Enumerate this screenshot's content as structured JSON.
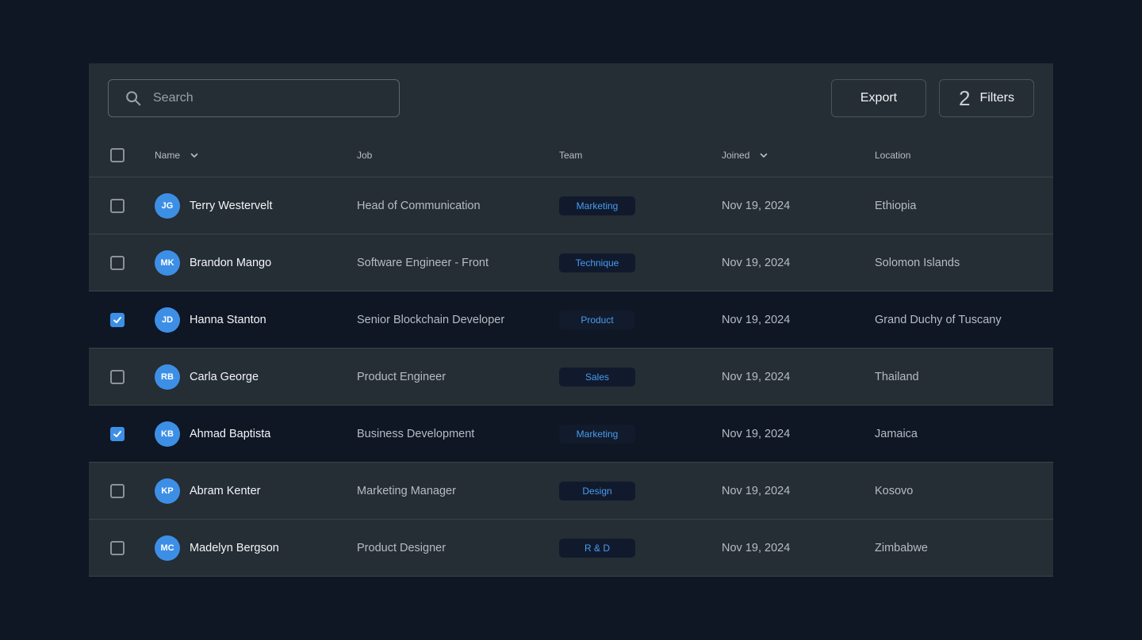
{
  "search": {
    "placeholder": "Search"
  },
  "toolbar": {
    "export_label": "Export",
    "filters_count": "2",
    "filters_label": "Filters"
  },
  "columns": {
    "name": "Name",
    "job": "Job",
    "team": "Team",
    "joined": "Joined",
    "location": "Location"
  },
  "colors": {
    "accent": "#3d8fe6",
    "background": "#0f1624",
    "panel": "#252d35",
    "badge_text": "#4a9bf2"
  },
  "rows": [
    {
      "initials": "JG",
      "name": "Terry Westervelt",
      "job": "Head of Communication",
      "team": "Marketing",
      "joined": "Nov 19, 2024",
      "location": "Ethiopia",
      "checked": false
    },
    {
      "initials": "MK",
      "name": "Brandon Mango",
      "job": "Software Engineer - Front",
      "team": "Technique",
      "joined": "Nov 19, 2024",
      "location": "Solomon Islands",
      "checked": false
    },
    {
      "initials": "JD",
      "name": "Hanna Stanton",
      "job": "Senior Blockchain Developer",
      "team": "Product",
      "joined": "Nov 19, 2024",
      "location": "Grand Duchy of Tuscany",
      "checked": true
    },
    {
      "initials": "RB",
      "name": "Carla George",
      "job": "Product Engineer",
      "team": "Sales",
      "joined": "Nov 19, 2024",
      "location": "Thailand",
      "checked": false
    },
    {
      "initials": "KB",
      "name": "Ahmad Baptista",
      "job": "Business Development",
      "team": "Marketing",
      "joined": "Nov 19, 2024",
      "location": "Jamaica",
      "checked": true
    },
    {
      "initials": "KP",
      "name": "Abram Kenter",
      "job": "Marketing Manager",
      "team": "Design",
      "joined": "Nov 19, 2024",
      "location": "Kosovo",
      "checked": false
    },
    {
      "initials": "MC",
      "name": "Madelyn Bergson",
      "job": "Product Designer",
      "team": "R & D",
      "joined": "Nov 19, 2024",
      "location": "Zimbabwe",
      "checked": false
    }
  ]
}
